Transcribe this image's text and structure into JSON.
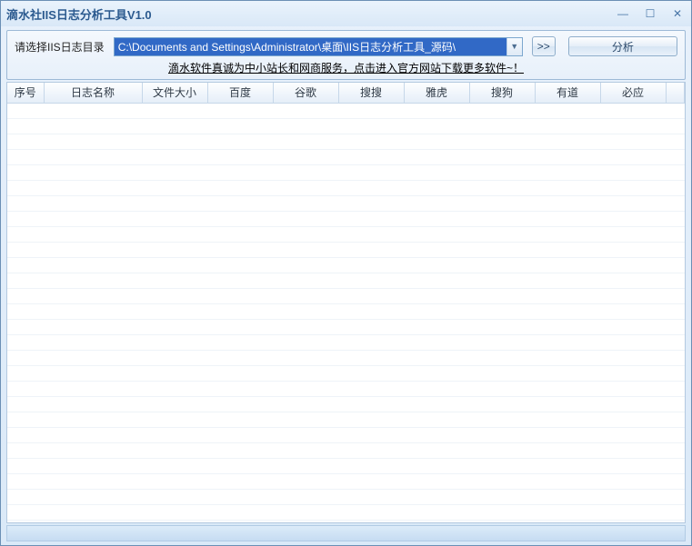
{
  "window": {
    "title": "滴水社IIS日志分析工具V1.0"
  },
  "toolbar": {
    "dir_label": "请选择IIS日志目录",
    "path_value": "C:\\Documents and Settings\\Administrator\\桌面\\IIS日志分析工具_源码\\",
    "browse_label": ">>",
    "analyze_label": "分析",
    "promo_text": "滴水软件真诚为中小站长和网商服务，点击进入官方网站下载更多软件~！"
  },
  "table": {
    "headers": [
      "序号",
      "日志名称",
      "文件大小",
      "百度",
      "谷歌",
      "搜搜",
      "雅虎",
      "搜狗",
      "有道",
      "必应",
      ""
    ],
    "rows": []
  }
}
